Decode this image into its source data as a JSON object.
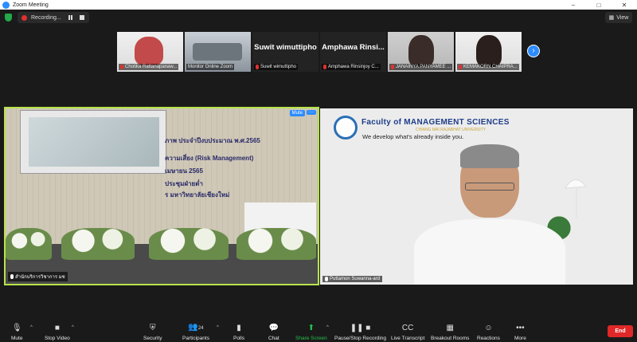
{
  "window": {
    "title": "Zoom Meeting",
    "controls": [
      "–",
      "□",
      "✕"
    ]
  },
  "topbar": {
    "recording_label": "Recording...",
    "view_label": "View"
  },
  "gallery": {
    "participants": [
      {
        "name": "Chotika Rattanapanaw...",
        "display": "photo"
      },
      {
        "name": "Monitor Online Zoom",
        "display": "photo"
      },
      {
        "name": "Suwit wimuttipho",
        "display": "name",
        "tile_text": "Suwit wimuttipho"
      },
      {
        "name": "Amphawa Rinsinjoy C...",
        "display": "name",
        "tile_text": "Amphawa Rinsi..."
      },
      {
        "name": "JANAINYA PANYAMEE ...",
        "display": "photo"
      },
      {
        "name": "KEMAKORN CHAIPRA...",
        "display": "photo"
      }
    ],
    "next_icon": "›"
  },
  "left_tile": {
    "name": "สำนักบริการวิชาการ มช",
    "mute_label": "Mute",
    "more_label": "···",
    "banner": [
      "ภาพ ประจำปีงบประมาณ พ.ศ.2565",
      "ความเสี่ยง (Risk Management)",
      "เมษายน 2565",
      "ประชุมฝ่ายต่ำ",
      "ร มหาวิทยาลัยเชียงใหม่"
    ]
  },
  "right_tile": {
    "name": "Puttamon Suwanna-ard",
    "faculty_title": "Faculty of MANAGEMENT SCIENCES",
    "faculty_sub": "CHIANG MAI RAJABHAT UNIVERSITY",
    "tagline": "We develop what's already inside you."
  },
  "toolbar": {
    "mute": "Mute",
    "stop_video": "Stop Video",
    "security": "Security",
    "participants": "Participants",
    "participants_count": "24",
    "polls": "Polls",
    "chat": "Chat",
    "share_screen": "Share Screen",
    "pause_recording": "Pause/Stop Recording",
    "live_transcript": "Live Transcript",
    "breakout_rooms": "Breakout Rooms",
    "reactions": "Reactions",
    "more": "More",
    "end": "End"
  },
  "colors": {
    "accent": "#2d8cff",
    "active_speaker": "#b7e34a",
    "end": "#e02828",
    "share": "#23c24a"
  }
}
